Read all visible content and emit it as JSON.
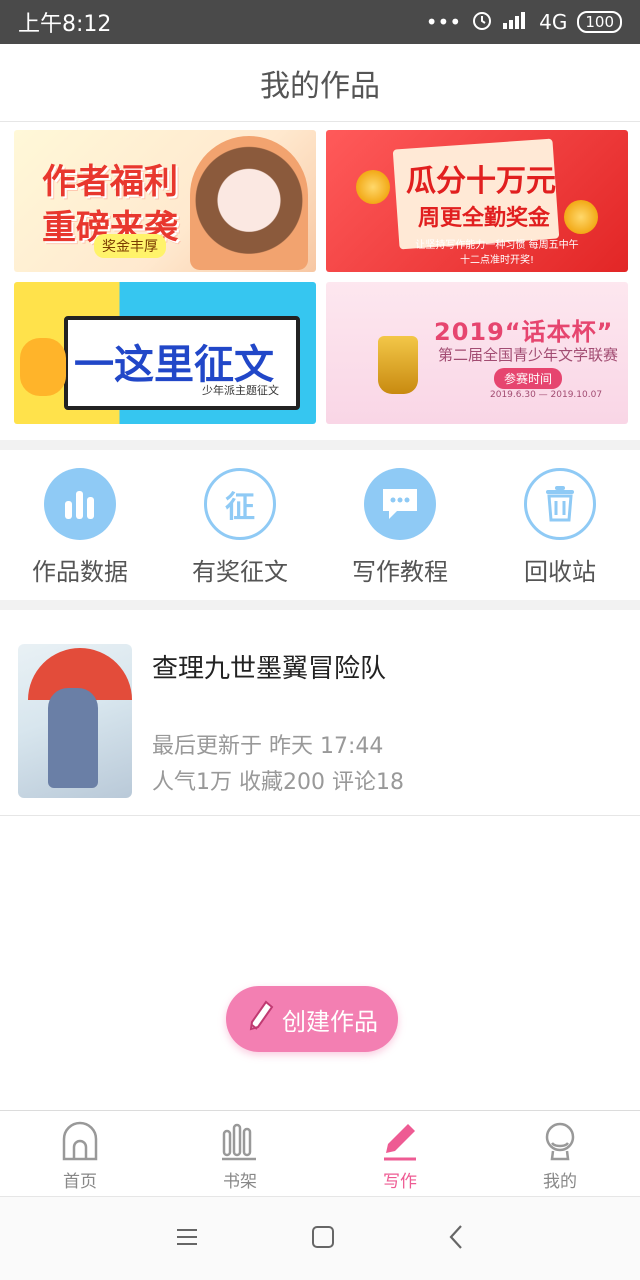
{
  "status_bar": {
    "time": "上午8:12",
    "dots": "•••",
    "network": "4G",
    "battery": "100"
  },
  "header": {
    "title": "我的作品"
  },
  "banners": [
    {
      "line1": "作者福利",
      "line2": "重磅来袭",
      "badge": "奖金丰厚"
    },
    {
      "line1": "瓜分十万元",
      "line2": "周更全勤奖金",
      "sub": "让坚持写作能力一种习惯 每周五中午十二点准时开奖!"
    },
    {
      "line1": "一这里征文",
      "sub": "少年派主题征文"
    },
    {
      "line1": "2019“话本杯”",
      "line2": "第二届全国青少年文学联赛",
      "pill": "参赛时间",
      "date": "2019.6.30 — 2019.10.07"
    }
  ],
  "quick_actions": [
    {
      "label": "作品数据",
      "icon": "bar-chart-icon"
    },
    {
      "label": "有奖征文",
      "icon": "contest-icon",
      "glyph": "征"
    },
    {
      "label": "写作教程",
      "icon": "chat-bubble-icon"
    },
    {
      "label": "回收站",
      "icon": "trash-icon"
    }
  ],
  "work": {
    "title": "查理九世墨翼冒险队",
    "updated": "最后更新于 昨天 17:44",
    "stats": "人气1万  收藏200  评论18"
  },
  "fab": {
    "label": "创建作品"
  },
  "tabbar": [
    {
      "label": "首页",
      "icon": "home-icon"
    },
    {
      "label": "书架",
      "icon": "bookshelf-icon"
    },
    {
      "label": "写作",
      "icon": "pen-icon",
      "active": true
    },
    {
      "label": "我的",
      "icon": "profile-icon"
    }
  ],
  "colors": {
    "accent": "#ee5b93",
    "icon_blue": "#8fcaf5",
    "fab": "#f37fb2"
  }
}
